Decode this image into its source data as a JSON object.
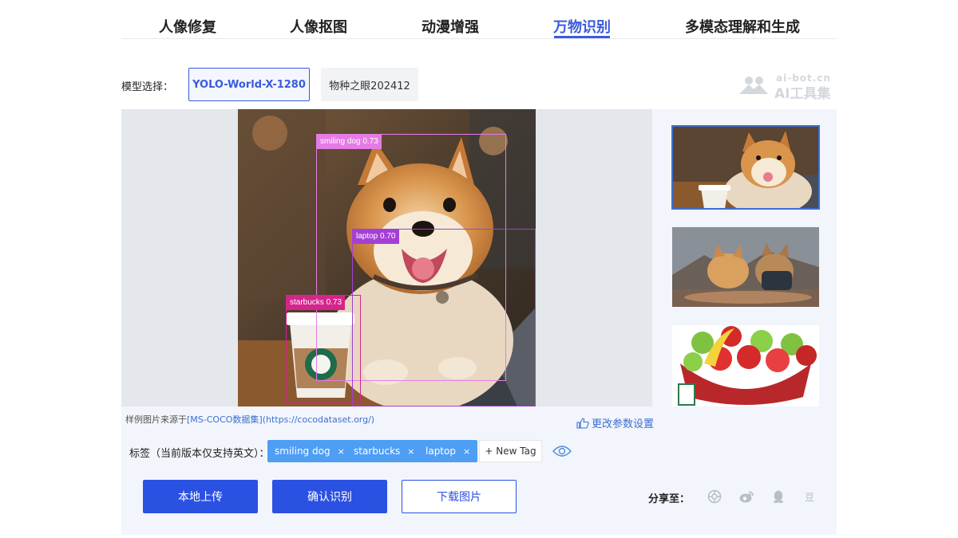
{
  "tabs": [
    {
      "label": "人像修复",
      "active": false
    },
    {
      "label": "人像抠图",
      "active": false
    },
    {
      "label": "动漫增强",
      "active": false
    },
    {
      "label": "万物识别",
      "active": true
    },
    {
      "label": "多模态理解和生成",
      "active": false
    }
  ],
  "model": {
    "label": "模型选择：",
    "options": [
      {
        "label": "YOLO-World-X-1280",
        "selected": true
      },
      {
        "label": "物种之眼202412",
        "selected": false
      }
    ]
  },
  "logo": {
    "url_text": "ai-bot.cn",
    "name": "AI工具集"
  },
  "detections": [
    {
      "label": "smiling dog 0.73",
      "color": "#e57be5"
    },
    {
      "label": "laptop 0.70",
      "color": "#a43fd6"
    },
    {
      "label": "starbucks 0.73",
      "color": "#d6248d"
    }
  ],
  "source_note": {
    "prefix": "样例图片来源于",
    "link": "[MS-COCO数据集](https://cocodataset.org/)"
  },
  "param_link": "更改参数设置",
  "thumbnails": [
    {
      "name": "shiba-cafe",
      "selected": true
    },
    {
      "name": "cats-on-board",
      "selected": false
    },
    {
      "name": "fruit-basket",
      "selected": false
    }
  ],
  "tags": {
    "label": "标签（当前版本仅支持英文）：",
    "items": [
      "smiling dog",
      "starbucks",
      "laptop"
    ],
    "remove_glyph": "×",
    "new_tag": "+ New Tag"
  },
  "actions": {
    "upload": "本地上传",
    "confirm": "确认识别",
    "download": "下载图片"
  },
  "share": {
    "label": "分享至：",
    "douban_glyph": "豆"
  },
  "colors": {
    "accent": "#2b51e3",
    "tab_active": "#3b5bdb",
    "tag": "#4e9ef5"
  }
}
